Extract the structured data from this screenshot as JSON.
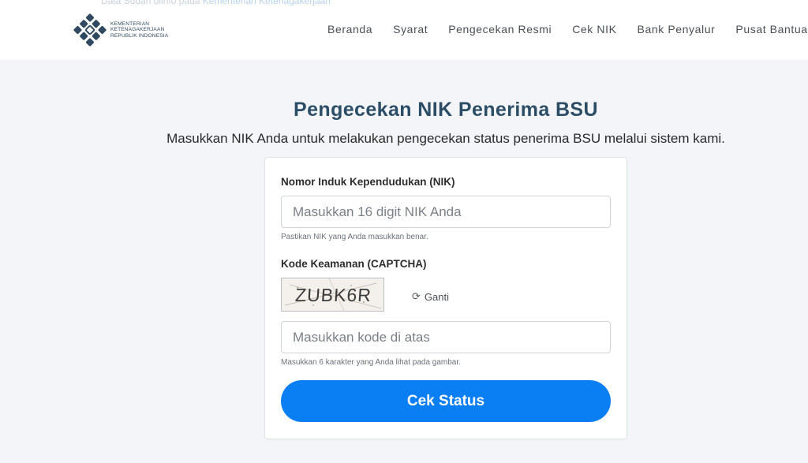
{
  "header": {
    "ghost_text": "Data Sudah diinfo pada",
    "ghost_link": "Kementerian Ketenagakerjaan",
    "logo": {
      "line1": "KEMENTERIAN",
      "line2": "KETENAGAKERJAAN",
      "line3": "REPUBLIK INDONESIA",
      "icon": "kemnaker-logo-icon",
      "color": "#2f4a60"
    },
    "nav": [
      "Beranda",
      "Syarat",
      "Pengecekan Resmi",
      "Cek NIK",
      "Bank Penyalur",
      "Pusat Bantuan"
    ]
  },
  "page": {
    "title": "Pengecekan NIK Penerima BSU",
    "subtitle": "Masukkan NIK Anda untuk melakukan pengecekan status penerima BSU melalui sistem kami."
  },
  "form": {
    "nik_label": "Nomor Induk Kependudukan (NIK)",
    "nik_placeholder": "Masukkan 16 digit NIK Anda",
    "nik_value": "",
    "nik_hint": "Pastikan NIK yang Anda masukkan benar.",
    "captcha_label": "Kode Keamanan (CAPTCHA)",
    "captcha_text": "ZUBK6R",
    "refresh_icon": "refresh-icon",
    "refresh_label": "Ganti",
    "captcha_placeholder": "Masukkan kode di atas",
    "captcha_value": "",
    "captcha_hint": "Masukkan 6 karakter yang Anda lihat pada gambar.",
    "submit_label": "Cek Status"
  },
  "colors": {
    "accent": "#0a7ef3",
    "title": "#2c4d66",
    "background": "#f3f5f8"
  }
}
